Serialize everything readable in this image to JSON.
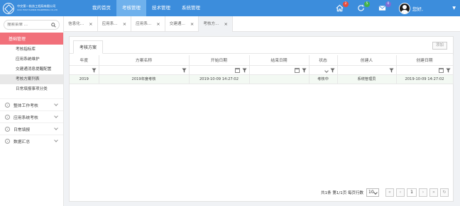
{
  "app": {
    "company_name": "中交第一航务工程局有限公司",
    "company_name_en": "CCCC FIRST HARBOR ENGINEERING CO.,LTD",
    "colors": {
      "topbar": "#3c8ddc",
      "active_nav": "#6fb1ec",
      "sidebar_active": "#f1707a",
      "row_highlight": "#f3f9f3"
    }
  },
  "nav": {
    "items": [
      {
        "label": "我的首页"
      },
      {
        "label": "考核管理"
      },
      {
        "label": "技术管理"
      },
      {
        "label": "系统管理"
      }
    ],
    "active_index": 1
  },
  "topright": {
    "home_badge": "2",
    "refresh_badge": "5",
    "mail_badge": "0",
    "username": "您好,",
    "badge_colors": [
      "#e84c3d",
      "#43b14b",
      "#7b6fd6"
    ]
  },
  "sidebar": {
    "search_placeholder": "搜索菜单 ...",
    "active_group": "基础管理",
    "sub_items": [
      "考核指标库",
      "应用系统维护",
      "交建通消息提醒配置",
      "考核方案列表",
      "日常填报事项分类"
    ],
    "selected_sub": 3,
    "groups": [
      "整体工作考核",
      "应用系统考核",
      "日常填报",
      "数据汇总"
    ]
  },
  "tabs": [
    {
      "label": "信息化..."
    },
    {
      "label": "应用系..."
    },
    {
      "label": "应用系..."
    },
    {
      "label": "交建通..."
    },
    {
      "label": "考核方..."
    }
  ],
  "panel": {
    "tab_label": "考核方案",
    "add_button": "添加"
  },
  "table": {
    "headers": [
      "年度",
      "方案名称",
      "开始日期",
      "结束日期",
      "状态",
      "创建人",
      "创建日期"
    ],
    "rows": [
      [
        "2019",
        "2019年度考核",
        "2019-10-09 14:27:02",
        "",
        "考核中",
        "系统管理员",
        "2019-10-09 14:27:02"
      ]
    ]
  },
  "pager": {
    "info": "共1条 第1/1页 每页行数",
    "page_size": "10",
    "current_page": "1"
  }
}
